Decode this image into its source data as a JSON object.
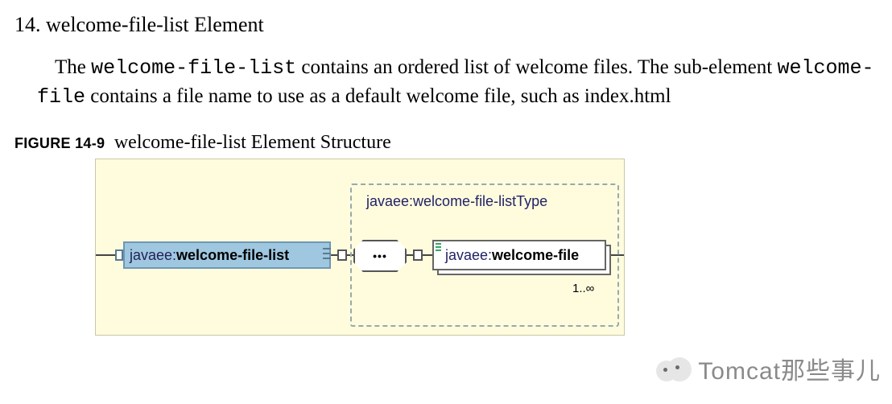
{
  "section": {
    "number": "14.",
    "title": "welcome-file-list Element"
  },
  "paragraph": {
    "pre1": "The ",
    "code1": "welcome-file-list",
    "mid1": " contains an ordered list of welcome files. The sub-element ",
    "code2": "welcome-file",
    "mid2": " contains a file name to use as a default welcome file, such as index.html"
  },
  "figure": {
    "label": "FIGURE 14-9",
    "title": "welcome-file-list Element Structure"
  },
  "diagram": {
    "main_ns": "javaee:",
    "main_el": "welcome-file-list",
    "group_label": "javaee:welcome-file-listType",
    "child_ns": "javaee:",
    "child_el": "welcome-file",
    "sequence_glyph": "•••",
    "cardinality": "1..∞"
  },
  "watermark": {
    "text": "Tomcat那些事儿"
  }
}
